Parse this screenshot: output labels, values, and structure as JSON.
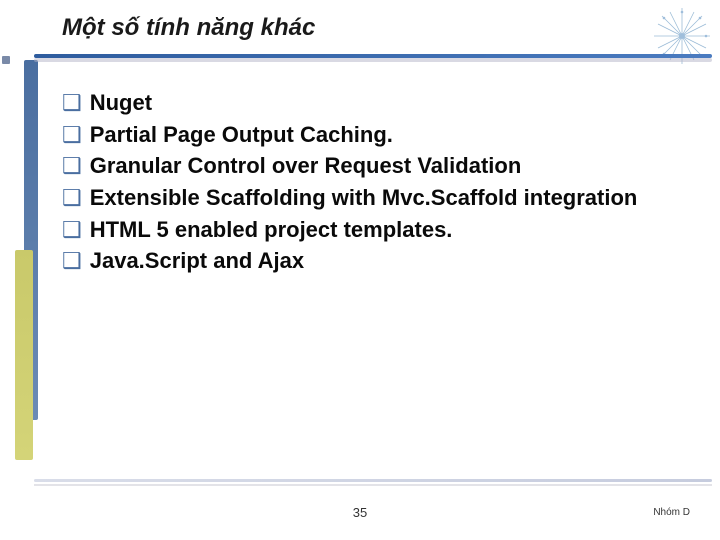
{
  "title": "Một số tính năng khác",
  "bullets": [
    "Nuget",
    "Partial Page Output Caching.",
    "Granular Control over Request Validation",
    "Extensible Scaffolding with Mvc.Scaffold integration",
    "HTML 5 enabled project templates.",
    "Java.Script and Ajax"
  ],
  "page_number": "35",
  "footer_right": "Nhóm D",
  "colors": {
    "accent_blue": "#4a6ea0",
    "rule_blue": "#2e5c9e"
  }
}
